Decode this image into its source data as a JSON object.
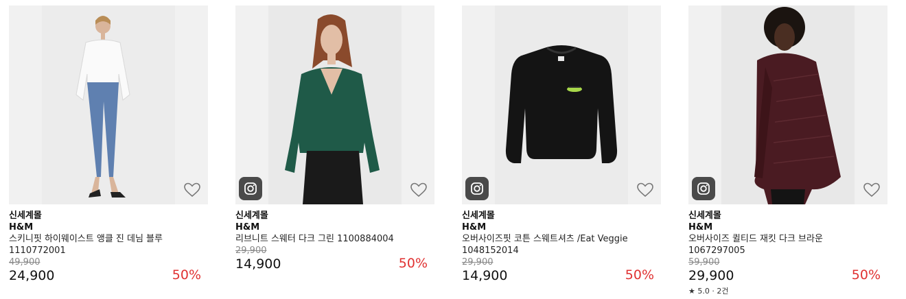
{
  "products": [
    {
      "store": "신세계몰",
      "brand": "H&M",
      "name_line1": "스키니핏 하이웨이스트 앵클 진 데님 블루",
      "name_line2": "1110772001",
      "original_price": "49,900",
      "price": "24,900",
      "discount": "50%",
      "has_instagram": false,
      "rating": ""
    },
    {
      "store": "신세계몰",
      "brand": "H&M",
      "name_line1": "리브니트 스웨터 다크 그린 1100884004",
      "name_line2": "",
      "original_price": "29,900",
      "price": "14,900",
      "discount": "50%",
      "has_instagram": true,
      "rating": ""
    },
    {
      "store": "신세계몰",
      "brand": "H&M",
      "name_line1": "오버사이즈핏 코튼 스웨트셔츠 /Eat Veggie",
      "name_line2": "1048152014",
      "original_price": "29,900",
      "price": "14,900",
      "discount": "50%",
      "has_instagram": true,
      "rating": ""
    },
    {
      "store": "신세계몰",
      "brand": "H&M",
      "name_line1": "오버사이즈 퀼티드 재킷 다크 브라운",
      "name_line2": "1067297005",
      "original_price": "59,900",
      "price": "29,900",
      "discount": "50%",
      "has_instagram": true,
      "rating": "★ 5.0 · 2건"
    }
  ],
  "colors": {
    "discount": "#e03131",
    "thumb_bg": "#f1f1f1",
    "instagram_badge": "#4a4a4a"
  },
  "icons": {
    "wishlist": "heart-icon",
    "instagram": "instagram-icon"
  }
}
